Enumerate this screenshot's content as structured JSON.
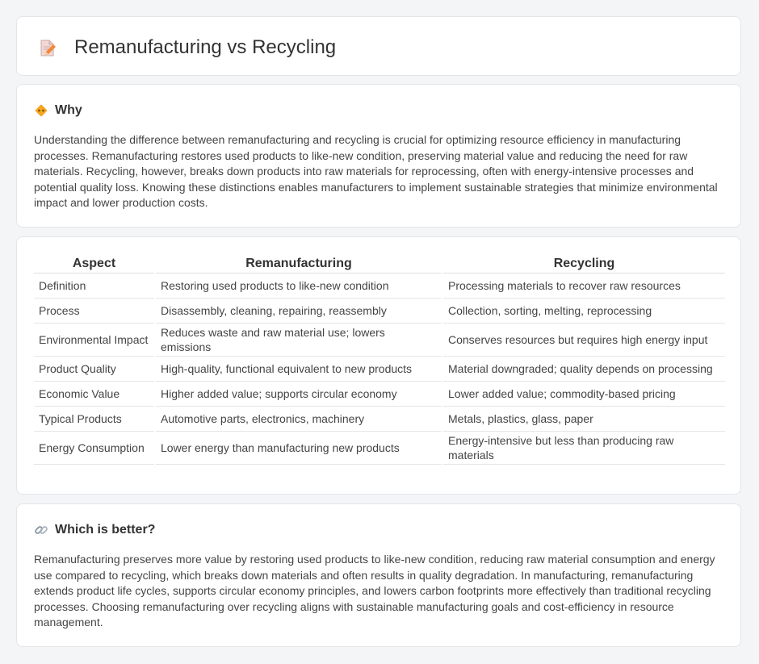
{
  "header": {
    "title": "Remanufacturing vs Recycling",
    "icon": "document-pencil-icon"
  },
  "why": {
    "title": "Why",
    "icon": "diamond-warning-icon",
    "text": "Understanding the difference between remanufacturing and recycling is crucial for optimizing resource efficiency in manufacturing processes. Remanufacturing restores used products to like-new condition, preserving material value and reducing the need for raw materials. Recycling, however, breaks down products into raw materials for reprocessing, often with energy-intensive processes and potential quality loss. Knowing these distinctions enables manufacturers to implement sustainable strategies that minimize environmental impact and lower production costs."
  },
  "table": {
    "headers": [
      "Aspect",
      "Remanufacturing",
      "Recycling"
    ],
    "rows": [
      [
        "Definition",
        "Restoring used products to like-new condition",
        "Processing materials to recover raw resources"
      ],
      [
        "Process",
        "Disassembly, cleaning, repairing, reassembly",
        "Collection, sorting, melting, reprocessing"
      ],
      [
        "Environmental Impact",
        "Reduces waste and raw material use; lowers emissions",
        "Conserves resources but requires high energy input"
      ],
      [
        "Product Quality",
        "High-quality, functional equivalent to new products",
        "Material downgraded; quality depends on processing"
      ],
      [
        "Economic Value",
        "Higher added value; supports circular economy",
        "Lower added value; commodity-based pricing"
      ],
      [
        "Typical Products",
        "Automotive parts, electronics, machinery",
        "Metals, plastics, glass, paper"
      ],
      [
        "Energy Consumption",
        "Lower energy than manufacturing new products",
        "Energy-intensive but less than producing raw materials"
      ]
    ]
  },
  "better": {
    "title": "Which is better?",
    "icon": "link-icon",
    "text": "Remanufacturing preserves more value by restoring used products to like-new condition, reducing raw material consumption and energy use compared to recycling, which breaks down materials and often results in quality degradation. In manufacturing, remanufacturing extends product life cycles, supports circular economy principles, and lowers carbon footprints more effectively than traditional recycling processes. Choosing remanufacturing over recycling aligns with sustainable manufacturing goals and cost-efficiency in resource management."
  }
}
